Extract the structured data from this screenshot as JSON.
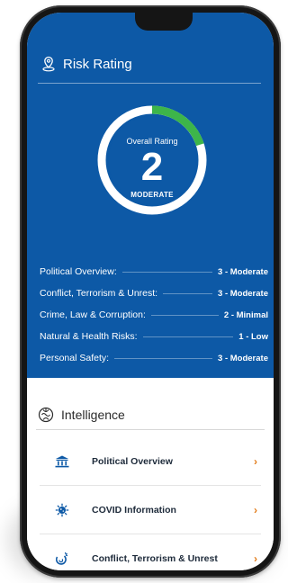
{
  "risk": {
    "title": "Risk Rating",
    "overall_label": "Overall Rating",
    "overall_value": "2",
    "overall_level": "MODERATE",
    "gauge_fill_fraction": 0.2,
    "items": [
      {
        "label": "Political Overview:",
        "value": "3 - Moderate"
      },
      {
        "label": "Conflict, Terrorism & Unrest:",
        "value": "3 - Moderate"
      },
      {
        "label": "Crime, Law & Corruption:",
        "value": "2 - Minimal"
      },
      {
        "label": "Natural & Health Risks:",
        "value": "1 - Low"
      },
      {
        "label": "Personal Safety:",
        "value": "3 - Moderate"
      }
    ]
  },
  "intelligence": {
    "title": "Intelligence",
    "items": [
      {
        "label": "Political Overview",
        "icon": "government-building-icon"
      },
      {
        "label": "COVID Information",
        "icon": "virus-icon"
      },
      {
        "label": "Conflict, Terrorism & Unrest",
        "icon": "explosion-icon"
      }
    ]
  },
  "colors": {
    "brand_blue": "#0d59a6",
    "gauge_green": "#3db54a",
    "chevron_orange": "#e27c1a"
  }
}
